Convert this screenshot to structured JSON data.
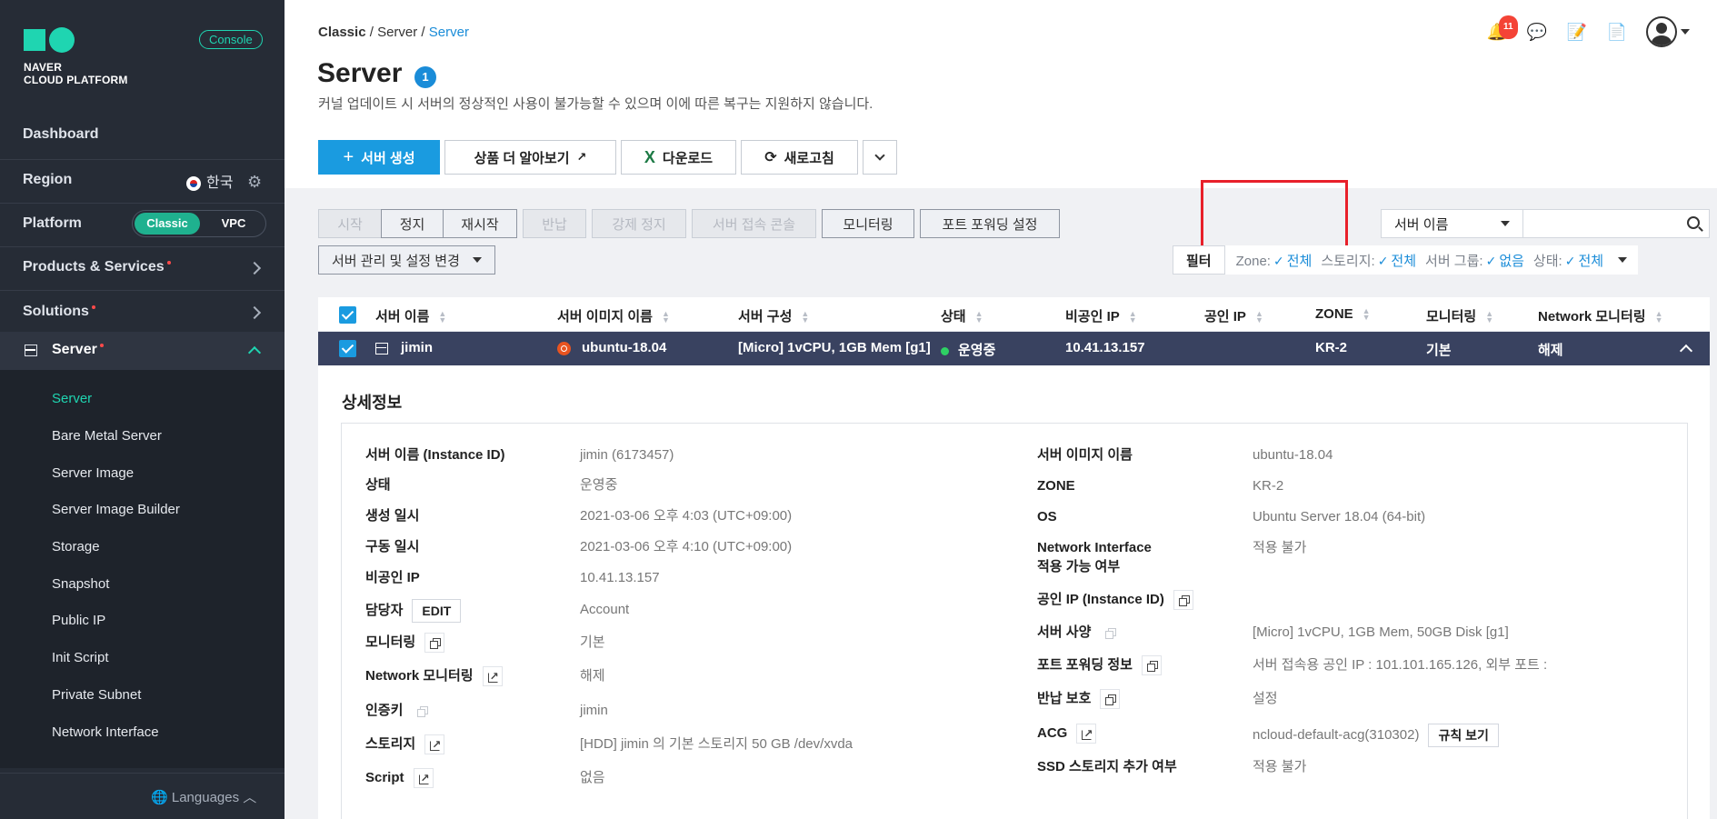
{
  "sidebar": {
    "logo_line1": "NAVER",
    "logo_line2": "CLOUD PLATFORM",
    "console": "Console",
    "dashboard": "Dashboard",
    "region": "Region",
    "region_value": "한국",
    "platform": "Platform",
    "platform_options": [
      "Classic",
      "VPC"
    ],
    "products": "Products & Services",
    "solutions": "Solutions",
    "server": "Server",
    "server_items": [
      "Server",
      "Bare Metal Server",
      "Server Image",
      "Server Image Builder",
      "Storage",
      "Snapshot",
      "Public IP",
      "Init Script",
      "Private Subnet",
      "Network Interface"
    ],
    "languages": "Languages"
  },
  "header": {
    "breadcrumb": [
      "Classic",
      "Server",
      "Server"
    ],
    "title": "Server",
    "count": "1",
    "subtitle": "커널 업데이트 시 서버의 정상적인 사용이 불가능할 수 있으며 이에 따른 복구는 지원하지 않습니다.",
    "notif_count": "11"
  },
  "toolbar": {
    "create": "서버 생성",
    "learn_more": "상품 더 알아보기",
    "download": "다운로드",
    "refresh": "새로고침"
  },
  "actions": {
    "start": "시작",
    "stop": "정지",
    "restart": "재시작",
    "return": "반납",
    "force_stop": "강제 정지",
    "console": "서버 접속 콘솔",
    "monitoring": "모니터링",
    "port_forwarding": "포트 포워딩 설정",
    "manage": "서버 관리 및 설정 변경"
  },
  "search": {
    "select": "서버 이름"
  },
  "filter": {
    "label": "필터",
    "zone_label": "Zone:",
    "zone_value": "전체",
    "storage_label": "스토리지:",
    "storage_value": "전체",
    "group_label": "서버 그룹:",
    "group_value": "없음",
    "status_label": "상태:",
    "status_value": "전체"
  },
  "table": {
    "headers": [
      "서버 이름",
      "서버 이미지 이름",
      "서버 구성",
      "상태",
      "비공인 IP",
      "공인 IP",
      "ZONE",
      "모니터링",
      "Network 모니터링"
    ],
    "row": {
      "name": "jimin",
      "image": "ubuntu-18.04",
      "spec": "[Micro] 1vCPU, 1GB Mem [g1]",
      "status": "운영중",
      "private_ip": "10.41.13.157",
      "public_ip": "",
      "zone": "KR-2",
      "monitoring": "기본",
      "net_monitoring": "해제"
    }
  },
  "detail": {
    "title": "상세정보",
    "left": [
      {
        "label": "서버 이름 (Instance ID)",
        "value": "jimin (6173457)"
      },
      {
        "label": "상태",
        "value": "운영중"
      },
      {
        "label": "생성 일시",
        "value": "2021-03-06 오후 4:03 (UTC+09:00)"
      },
      {
        "label": "구동 일시",
        "value": "2021-03-06 오후 4:10 (UTC+09:00)"
      },
      {
        "label": "비공인 IP",
        "value": "10.41.13.157"
      },
      {
        "label": "담당자",
        "value": "Account"
      },
      {
        "label": "모니터링",
        "value": "기본"
      },
      {
        "label": "Network 모니터링",
        "value": "해제"
      },
      {
        "label": "인증키",
        "value": "jimin"
      },
      {
        "label": "스토리지",
        "value": "[HDD] jimin 의 기본 스토리지  50 GB /dev/xvda"
      },
      {
        "label": "Script",
        "value": "없음"
      }
    ],
    "edit": "EDIT",
    "right": [
      {
        "label": "서버 이미지 이름",
        "value": "ubuntu-18.04"
      },
      {
        "label": "ZONE",
        "value": "KR-2"
      },
      {
        "label": "OS",
        "value": "Ubuntu Server 18.04 (64-bit)"
      },
      {
        "label": "Network Interface",
        "label2": "적용 가능 여부",
        "value": "적용 불가"
      },
      {
        "label": "공인 IP (Instance ID)",
        "value": ""
      },
      {
        "label": "서버 사양",
        "value": "[Micro] 1vCPU, 1GB Mem, 50GB Disk [g1]"
      },
      {
        "label": "포트 포워딩 정보",
        "value": "서버 접속용 공인 IP : 101.101.165.126, 외부 포트 :"
      },
      {
        "label": "반납 보호",
        "value": "설정"
      },
      {
        "label": "ACG",
        "value": "ncloud-default-acg(310302)"
      },
      {
        "label": "SSD 스토리지 추가 여부",
        "value": "적용 불가"
      }
    ],
    "rules_btn": "규칙 보기"
  },
  "colors": {
    "sidebar_bg": "#262c36",
    "accent_teal": "#1fd5b1",
    "primary_blue": "#1a9be0",
    "selected_row": "#394260",
    "highlight_red": "#e8202a"
  }
}
